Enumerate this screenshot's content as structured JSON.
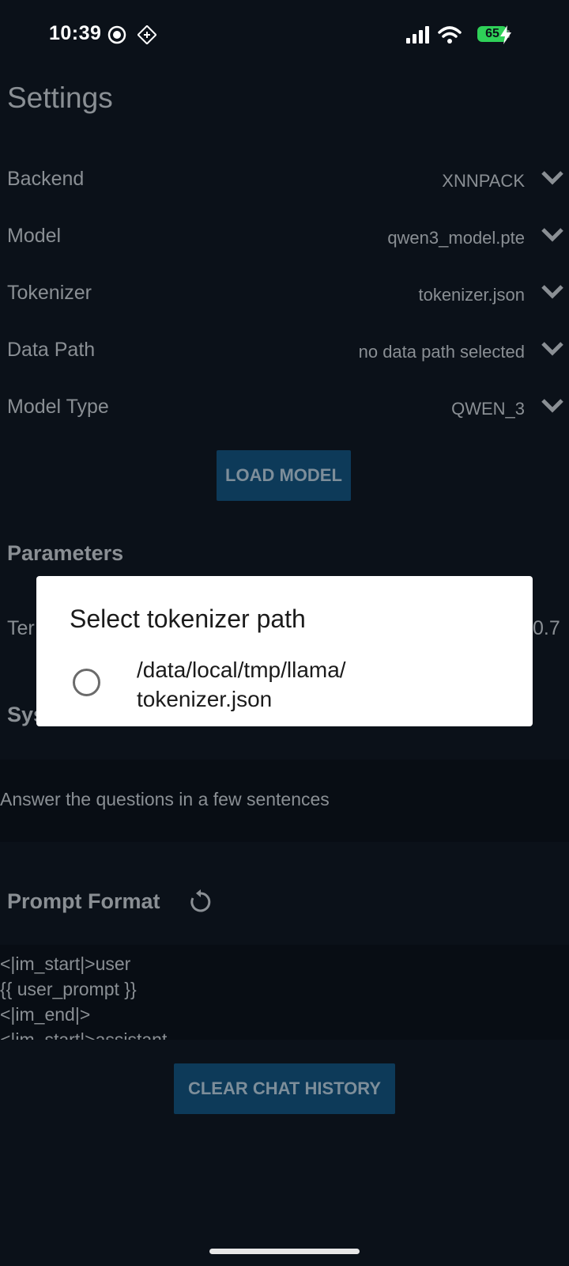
{
  "status_bar": {
    "time": "10:39",
    "battery": "65",
    "icons": [
      "record-icon",
      "sync-icon",
      "signal-icon",
      "wifi-icon",
      "battery-icon",
      "charging-icon"
    ]
  },
  "settings": {
    "title": "Settings",
    "rows": [
      {
        "label": "Backend",
        "value": "XNNPACK"
      },
      {
        "label": "Model",
        "value": "qwen3_model.pte"
      },
      {
        "label": "Tokenizer",
        "value": "tokenizer.json"
      },
      {
        "label": "Data Path",
        "value": "no data path selected"
      },
      {
        "label": "Model Type",
        "value": "QWEN_3"
      }
    ],
    "load_button": "LOAD MODEL"
  },
  "parameters": {
    "title": "Parameters",
    "temperature_label_visible": "Ter",
    "temperature_value": "0.7"
  },
  "system_prompt": {
    "title_visible": "Sys",
    "value": "Answer the questions in a few sentences"
  },
  "prompt_format": {
    "title": "Prompt Format",
    "lines": [
      "<|im_start|>user",
      "{{ user_prompt }}",
      "<|im_end|>",
      "<|im_start|>assistant"
    ]
  },
  "clear_button": "CLEAR CHAT HISTORY",
  "dialog": {
    "title": "Select tokenizer path",
    "options": [
      "/data/local/tmp/llama/tokenizer.json"
    ],
    "option_line1": "/data/local/tmp/llama/",
    "option_line2": "tokenizer.json"
  },
  "colors": {
    "background": "#0b1119",
    "button": "#0d3a59",
    "battery": "#2fd158",
    "dialog": "#ffffff"
  }
}
